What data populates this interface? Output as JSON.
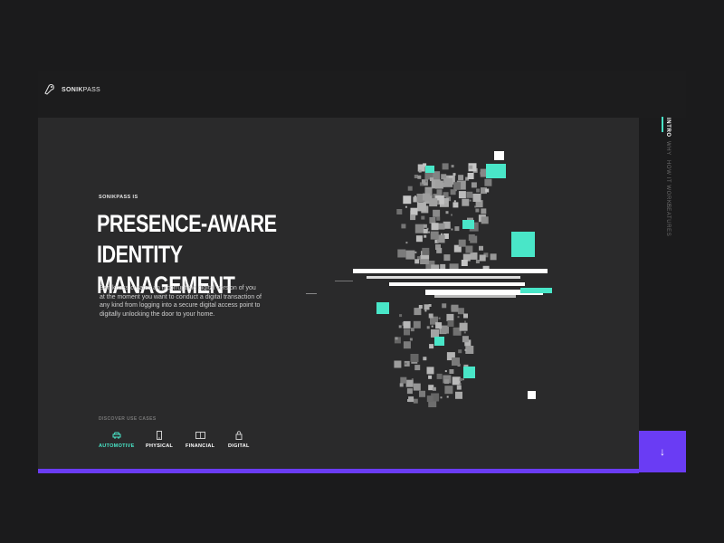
{
  "brand": {
    "name_bold": "SONIK",
    "name_light": "PASS"
  },
  "hero": {
    "eyebrow": "SONIKPASS IS",
    "headline_line1": "PRESENCE-AWARE",
    "headline_line2": "IDENTITY MANAGEMENT",
    "description": "Sonikpass creates an incorruptible digital version of you at the moment you want to conduct a digital transaction of any kind from logging into a secure digital access point to digitally unlocking the door to your home."
  },
  "use_cases": {
    "heading": "DISCOVER USE CASES",
    "items": [
      {
        "label": "AUTOMOTIVE",
        "icon": "car-icon",
        "active": true
      },
      {
        "label": "PHYSICAL",
        "icon": "phone-icon",
        "active": false
      },
      {
        "label": "FINANCIAL",
        "icon": "card-icon",
        "active": false
      },
      {
        "label": "DIGITAL",
        "icon": "lock-icon",
        "active": false
      }
    ]
  },
  "side_nav": {
    "items": [
      {
        "label": "INTRO",
        "active": true
      },
      {
        "label": "WHY",
        "active": false
      },
      {
        "label": "HOW IT WORKS",
        "active": false
      },
      {
        "label": "FEATURES",
        "active": false
      }
    ]
  },
  "scroll_button": {
    "icon": "arrow-down-icon",
    "glyph": "↓"
  },
  "colors": {
    "accent": "#49e6c8",
    "brand": "#6a3cf4",
    "panel": "#2a2a2b",
    "background": "#1b1b1c"
  }
}
